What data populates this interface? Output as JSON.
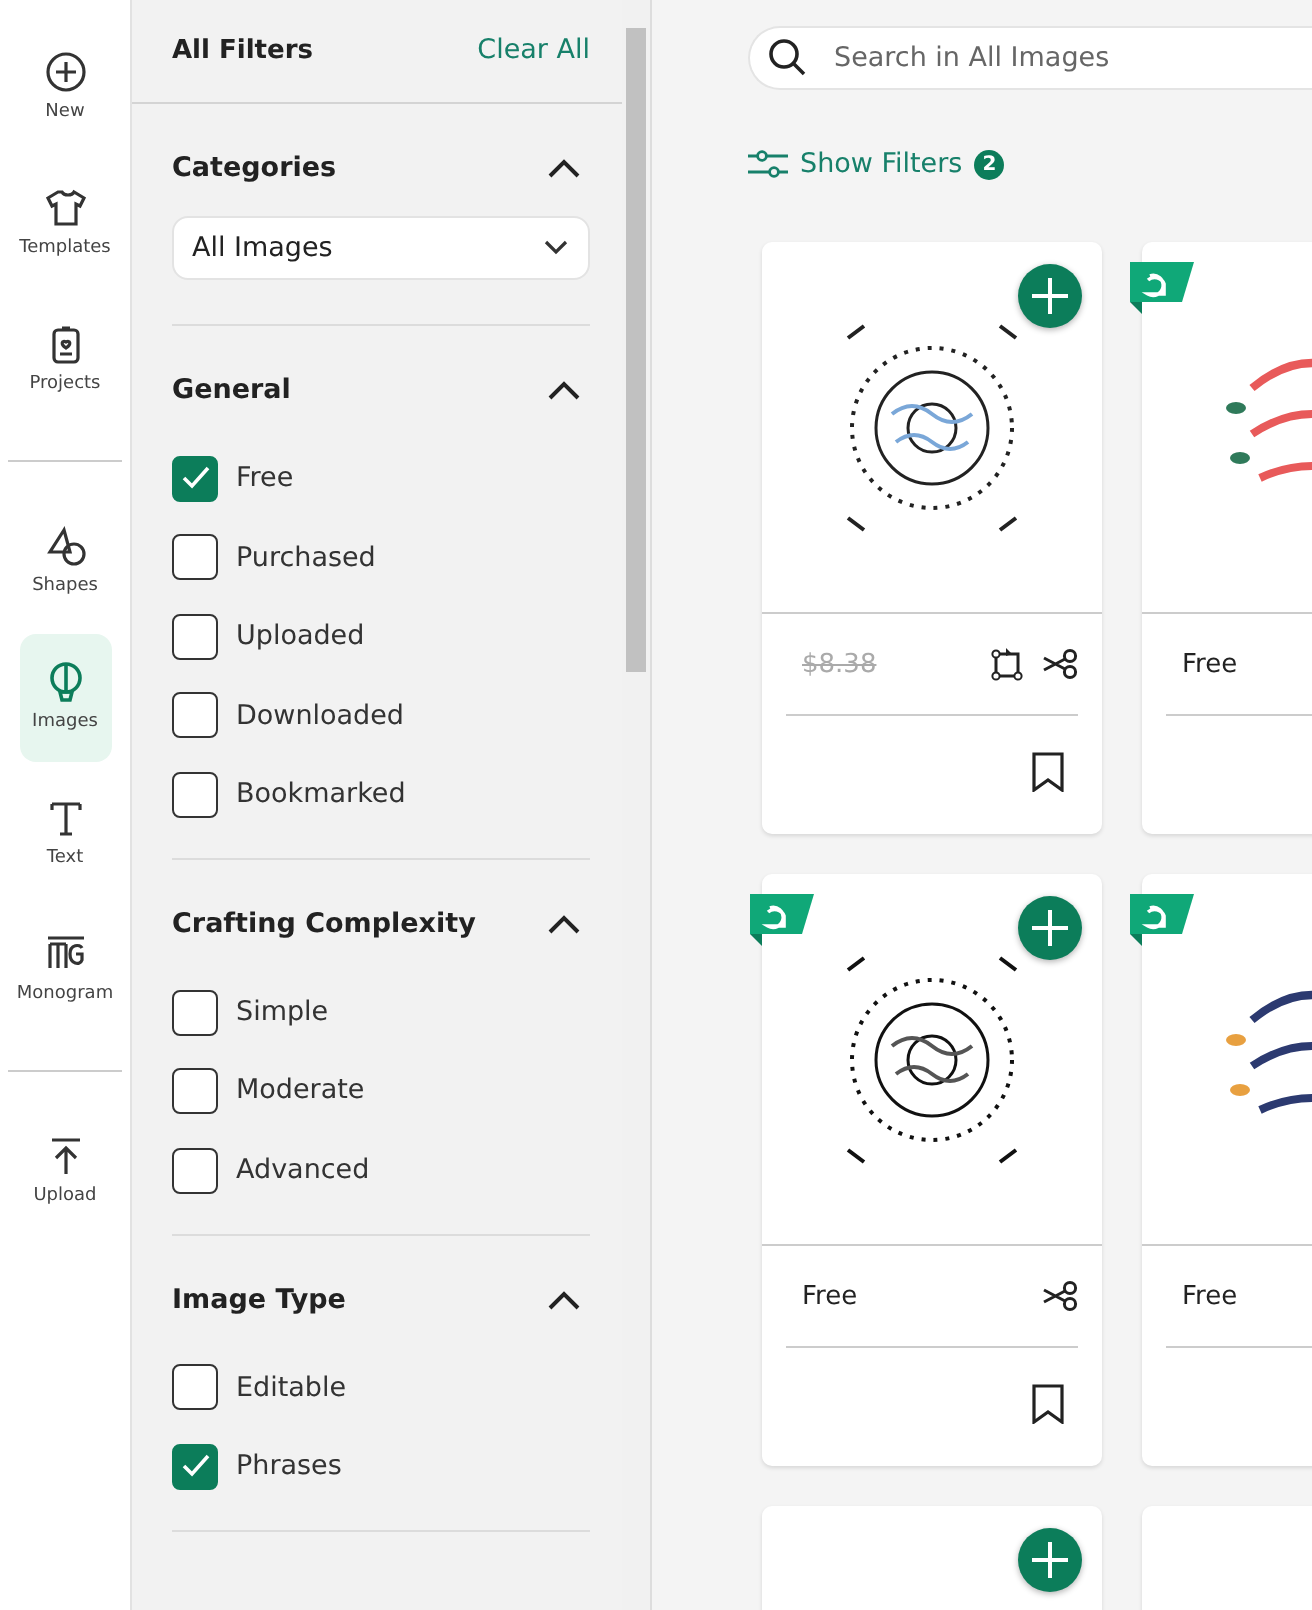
{
  "rail": {
    "groups": [
      [
        {
          "label": "New",
          "selected": false
        },
        {
          "label": "Templates",
          "selected": false
        },
        {
          "label": "Projects",
          "selected": false
        }
      ],
      [
        {
          "label": "Shapes",
          "selected": false
        },
        {
          "label": "Images",
          "selected": true
        },
        {
          "label": "Text",
          "selected": false
        },
        {
          "label": "Monogram",
          "selected": false
        }
      ],
      [
        {
          "label": "Upload",
          "selected": false
        }
      ]
    ]
  },
  "filters": {
    "title": "All Filters",
    "clear": "Clear All",
    "sections": [
      {
        "title": "Categories",
        "expanded": true,
        "kind": "dropdown",
        "value": "All Images"
      },
      {
        "title": "General",
        "expanded": true,
        "kind": "checkboxes",
        "options": [
          {
            "label": "Free",
            "checked": true
          },
          {
            "label": "Purchased",
            "checked": false
          },
          {
            "label": "Uploaded",
            "checked": false
          },
          {
            "label": "Downloaded",
            "checked": false
          },
          {
            "label": "Bookmarked",
            "checked": false
          }
        ]
      },
      {
        "title": "Crafting Complexity",
        "expanded": true,
        "kind": "checkboxes",
        "options": [
          {
            "label": "Simple",
            "checked": false
          },
          {
            "label": "Moderate",
            "checked": false
          },
          {
            "label": "Advanced",
            "checked": false
          }
        ]
      },
      {
        "title": "Image Type",
        "expanded": true,
        "kind": "checkboxes",
        "options": [
          {
            "label": "Editable",
            "checked": false
          },
          {
            "label": "Phrases",
            "checked": true
          }
        ]
      }
    ]
  },
  "search": {
    "placeholder": "Search in All Images"
  },
  "show_filters": {
    "label": "Show Filters",
    "count": "2"
  },
  "cards": [
    {
      "price": "$8.38",
      "strikethrough": true,
      "ribbon": false,
      "add": true,
      "editable": true,
      "cuttable": true,
      "bookmark": true,
      "kind": "picture"
    },
    {
      "price": "Free",
      "strikethrough": false,
      "ribbon": true,
      "add": false,
      "editable": false,
      "cuttable": false,
      "bookmark": false,
      "kind": "picture"
    },
    {
      "price": "Free",
      "strikethrough": false,
      "ribbon": true,
      "add": true,
      "editable": false,
      "cuttable": true,
      "bookmark": true,
      "kind": "picture"
    },
    {
      "price": "Free",
      "strikethrough": false,
      "ribbon": true,
      "add": false,
      "editable": false,
      "cuttable": false,
      "bookmark": false,
      "kind": "picture"
    },
    {
      "ribbon": false,
      "add": true
    },
    {
      "ribbon": false
    }
  ]
}
